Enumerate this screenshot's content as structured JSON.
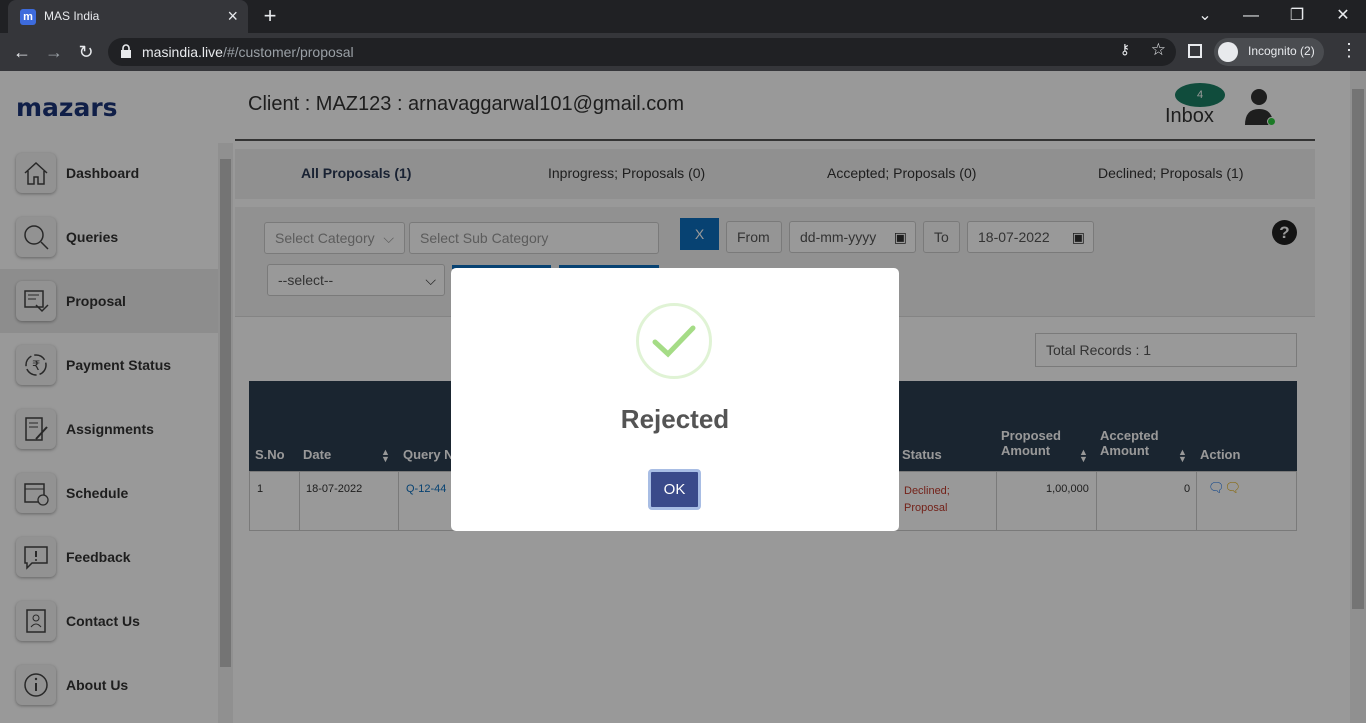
{
  "browser": {
    "tab_title": "MAS India",
    "tab_favicon": "m",
    "url_host": "masindia.live",
    "url_path": "/#/customer/proposal",
    "incognito_label": "Incognito (2)"
  },
  "sidebar": {
    "logo": "mazars",
    "items": [
      {
        "label": "Dashboard",
        "icon": "home-icon"
      },
      {
        "label": "Queries",
        "icon": "search-icon"
      },
      {
        "label": "Proposal",
        "icon": "proposal-icon"
      },
      {
        "label": "Payment Status",
        "icon": "rupee-cycle-icon"
      },
      {
        "label": "Assignments",
        "icon": "document-edit-icon"
      },
      {
        "label": "Schedule",
        "icon": "calendar-icon"
      },
      {
        "label": "Feedback",
        "icon": "feedback-icon"
      },
      {
        "label": "Contact Us",
        "icon": "contact-book-icon"
      },
      {
        "label": "About Us",
        "icon": "info-icon"
      }
    ]
  },
  "header": {
    "client": "Client : MAZ123 : arnavaggarwal101@gmail.com",
    "inbox_count": "4",
    "inbox_label": "Inbox"
  },
  "tabs": [
    "All Proposals (1)",
    "Inprogress; Proposals (0)",
    "Accepted; Proposals (0)",
    "Declined; Proposals (1)"
  ],
  "filters": {
    "category_placeholder": "Select Category",
    "subcategory_placeholder": "Select Sub Category",
    "clear_label": "X",
    "from_label": "From",
    "from_date": "dd-mm-yyyy",
    "to_label": "To",
    "to_date": "18-07-2022",
    "status_select": "--select--",
    "help": "?"
  },
  "total_records": "Total Records : 1",
  "table": {
    "headers": {
      "sno": "S.No",
      "date": "Date",
      "query": "Query N",
      "status": "Status",
      "proposed_1": "Proposed",
      "proposed_2": "Amount",
      "accepted_1": "Accepted",
      "accepted_2": "Amount",
      "action": "Action"
    },
    "rows": [
      {
        "sno": "1",
        "date": "18-07-2022",
        "query": "Q-12-44",
        "status_1": "Declined;",
        "status_2": "Proposal",
        "proposed": "1,00,000",
        "accepted": "0"
      }
    ]
  },
  "modal": {
    "title": "Rejected",
    "ok_label": "OK"
  },
  "colors": {
    "accent": "#0d6fbf",
    "table_header": "#2c3e50",
    "status_declined": "#c0392b",
    "ok_button": "#3a4a8a",
    "success_check": "#a5dc86"
  }
}
